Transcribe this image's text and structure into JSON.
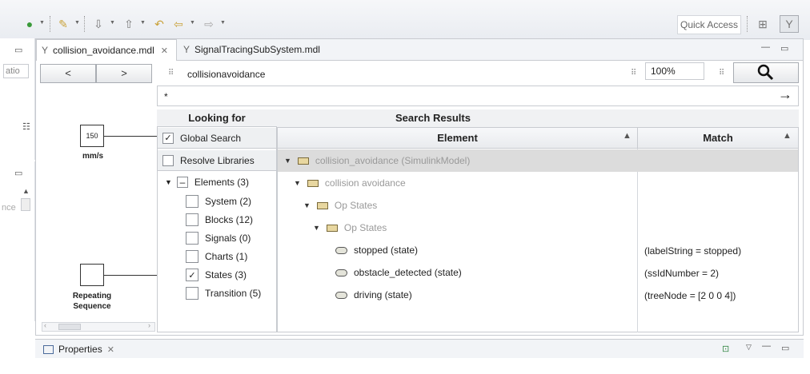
{
  "toolbar": {
    "quick_access": "Quick Access"
  },
  "left_panel": {
    "field_text": "atio",
    "field_text2": "nce"
  },
  "tabs": [
    {
      "label": "collision_avoidance.mdl",
      "close": "✕"
    },
    {
      "label": "SignalTracingSubSystem.mdl"
    }
  ],
  "nav": {
    "back_label": "<",
    "forward_label": ">",
    "path": "collisionavoidance",
    "zoom": "100%",
    "filter": "*",
    "go_arrow": "→"
  },
  "diagram": {
    "block1_value": "150",
    "block1_label": "mm/s",
    "block2_label_line1": "Repeating",
    "block2_label_line2": "Sequence"
  },
  "looking_for": {
    "header": "Looking for",
    "global_search": "Global Search",
    "global_search_checked": "✓",
    "resolve_libraries": "Resolve Libraries",
    "elements_label": "Elements (3)",
    "items": [
      {
        "label": "System (2)",
        "check": ""
      },
      {
        "label": "Blocks (12)",
        "check": ""
      },
      {
        "label": "Signals (0)",
        "check": ""
      },
      {
        "label": "Charts (1)",
        "check": ""
      },
      {
        "label": "States (3)",
        "check": "✓"
      },
      {
        "label": "Transition (5)",
        "check": ""
      }
    ]
  },
  "results": {
    "header": "Search Results",
    "col_element": "Element",
    "col_match": "Match",
    "rows": [
      {
        "element": "collision_avoidance (SimulinkModel)",
        "match": ""
      },
      {
        "element": "collision avoidance",
        "match": ""
      },
      {
        "element": "Op States",
        "match": ""
      },
      {
        "element": "Op States",
        "match": ""
      },
      {
        "element": "stopped (state)",
        "match": "(labelString = stopped)"
      },
      {
        "element": "obstacle_detected (state)",
        "match": "(ssIdNumber = 2)"
      },
      {
        "element": "driving (state)",
        "match": "(treeNode = [2 0 0 4])"
      }
    ]
  },
  "bottom": {
    "properties": "Properties",
    "close": "✕"
  }
}
